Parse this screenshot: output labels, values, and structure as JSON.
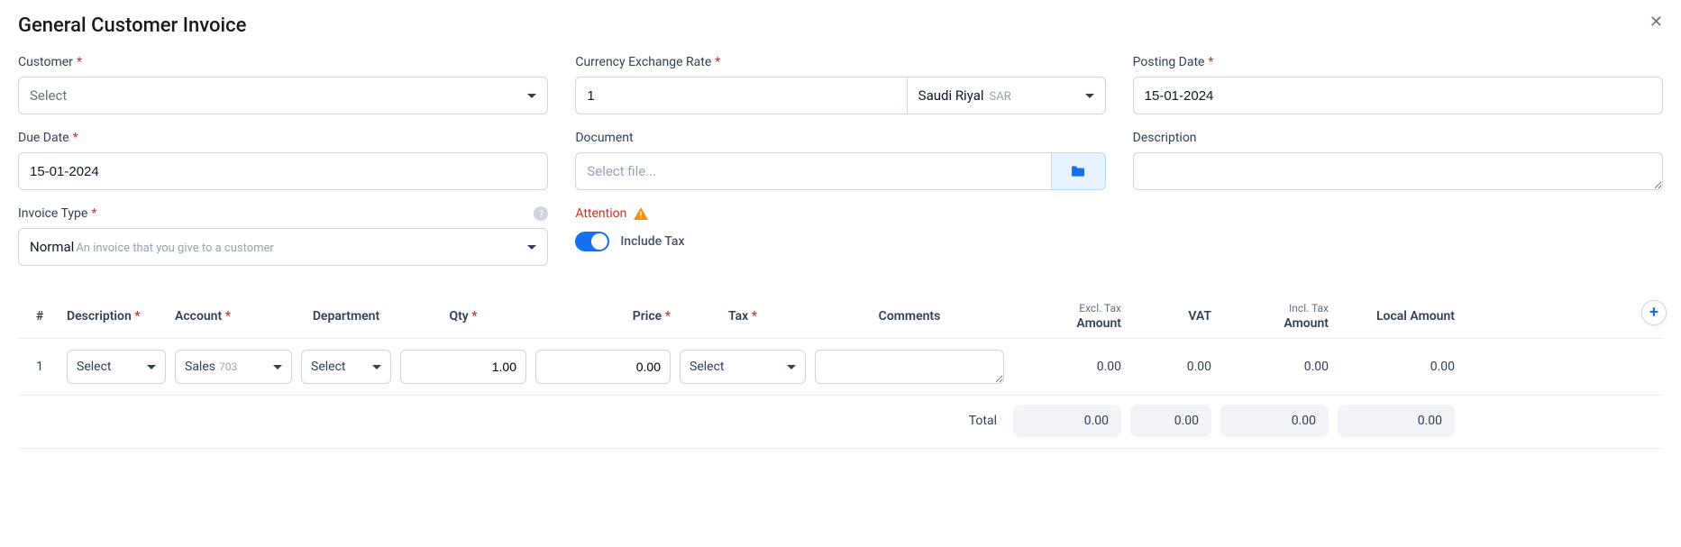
{
  "title": "General Customer Invoice",
  "labels": {
    "customer": "Customer",
    "currency_rate": "Currency Exchange Rate",
    "posting_date": "Posting Date",
    "due_date": "Due Date",
    "document": "Document",
    "description": "Description",
    "invoice_type": "Invoice Type",
    "attention": "Attention",
    "include_tax": "Include Tax",
    "select_placeholder": "Select",
    "select_file_placeholder": "Select file..."
  },
  "values": {
    "customer": "Select",
    "exchange_rate": "1",
    "currency_name": "Saudi Riyal",
    "currency_code": "SAR",
    "posting_date": "15-01-2024",
    "due_date": "15-01-2024",
    "invoice_type_main": "Normal",
    "invoice_type_sub": "An invoice that you give to a customer",
    "include_tax_on": true
  },
  "table": {
    "headers": {
      "num": "#",
      "description": "Description",
      "account": "Account",
      "department": "Department",
      "qty": "Qty",
      "price": "Price",
      "tax": "Tax",
      "comments": "Comments",
      "excl_sub": "Excl. Tax",
      "amount": "Amount",
      "vat": "VAT",
      "incl_sub": "Incl. Tax",
      "local_amount": "Local Amount"
    },
    "rows": [
      {
        "num": "1",
        "description": "Select",
        "account_name": "Sales",
        "account_code": "703",
        "department": "Select",
        "qty": "1.00",
        "price": "0.00",
        "tax": "Select",
        "comments": "",
        "excl_amount": "0.00",
        "vat": "0.00",
        "incl_amount": "0.00",
        "local_amount": "0.00"
      }
    ],
    "total_label": "Total",
    "totals": {
      "excl_amount": "0.00",
      "vat": "0.00",
      "incl_amount": "0.00",
      "local_amount": "0.00"
    }
  }
}
